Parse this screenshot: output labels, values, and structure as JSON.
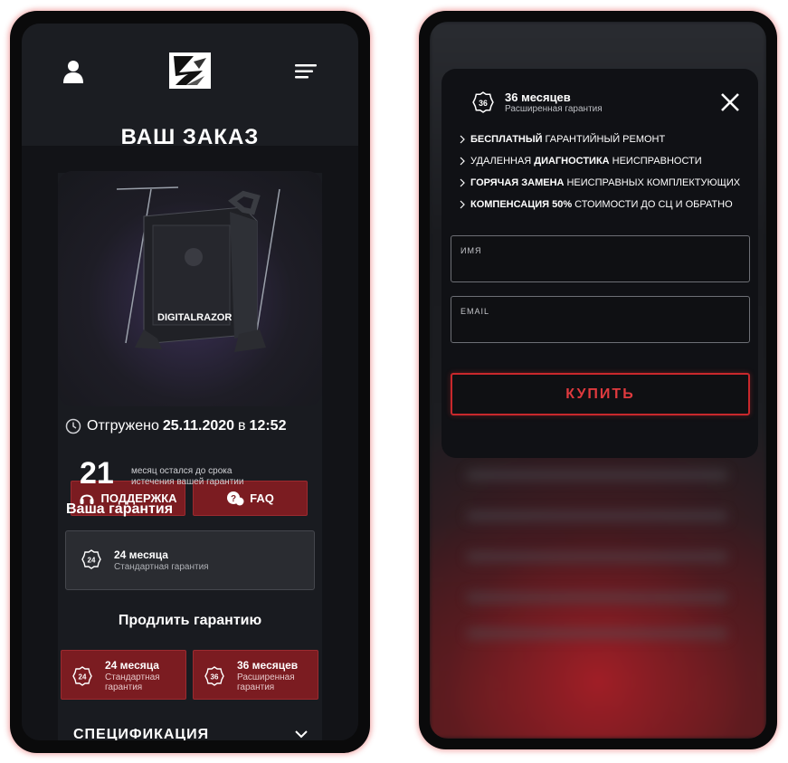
{
  "left_screen": {
    "title": "ВАШ ЗАКАЗ",
    "product": {
      "brand_text": "DIGITALRAZOR"
    },
    "buttons": {
      "support": "ПОДДЕРЖКА",
      "faq": "FAQ"
    },
    "shipped": {
      "label": "Отгружено",
      "date": "25.11.2020",
      "in": "в",
      "time": "12:52"
    },
    "warranty_remaining": {
      "number": "21",
      "text": "месяц остался до срока истечения вашей гарантии"
    },
    "your_warranty": {
      "heading": "Ваша гарантия",
      "badge": "24",
      "title": "24 месяца",
      "subtitle": "Стандартная гарантия"
    },
    "extend": {
      "heading": "Продлить гарантию",
      "options": [
        {
          "badge": "24",
          "title": "24 месяца",
          "subtitle": "Стандартная гарантия"
        },
        {
          "badge": "36",
          "title": "36 месяцев",
          "subtitle": "Расширенная гарантия"
        }
      ]
    },
    "spec": {
      "label": "СПЕЦИФИКАЦИЯ"
    }
  },
  "modal": {
    "badge": "36",
    "title": "36 месяцев",
    "subtitle": "Расширенная гарантия",
    "features": [
      {
        "bold": "БЕСПЛАТНЫЙ",
        "rest": "ГАРАНТИЙНЫЙ РЕМОНТ",
        "pre": ""
      },
      {
        "pre": "УДАЛЕННАЯ",
        "bold": "ДИАГНОСТИКА",
        "rest": "НЕИСПРАВНОСТИ"
      },
      {
        "bold": "ГОРЯЧАЯ ЗАМЕНА",
        "rest": "НЕИСПРАВНЫХ КОМПЛЕКТУЮЩИХ",
        "pre": ""
      },
      {
        "bold": "КОМПЕНСАЦИЯ 50%",
        "rest": "СТОИМОСТИ ДО СЦ И ОБРАТНО",
        "pre": ""
      }
    ],
    "fields": {
      "name_label": "ИМЯ",
      "email_label": "EMAIL",
      "name_value": "",
      "email_value": ""
    },
    "buy_label": "КУПИТЬ"
  },
  "colors": {
    "accent_red": "#7b1c21",
    "buy_red": "#e03a3e",
    "background": "#14161a"
  }
}
